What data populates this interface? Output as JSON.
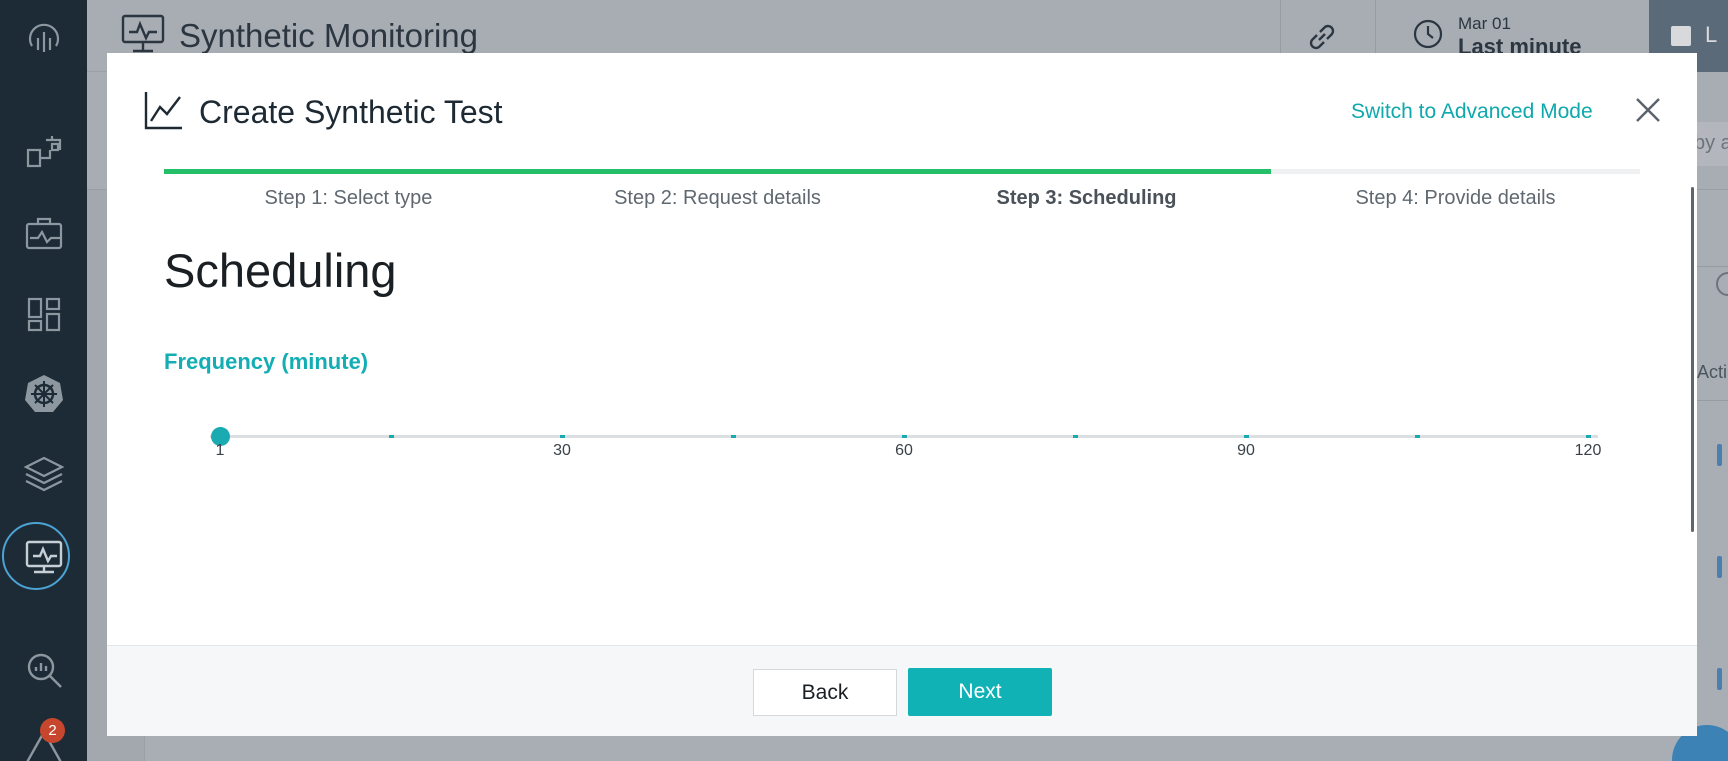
{
  "app": {
    "title": "Synthetic Monitoring",
    "time_picker": {
      "date": "Mar 01",
      "range": "Last minute"
    },
    "right_strip_letter": "L"
  },
  "background_peek": {
    "search_fragment": "by a",
    "column_fragment": "Acti"
  },
  "nav": {
    "items": [
      {
        "name": "logo-icon"
      },
      {
        "name": "dashboards-icon"
      },
      {
        "name": "infrastructure-icon"
      },
      {
        "name": "applications-icon"
      },
      {
        "name": "kubernetes-icon"
      },
      {
        "name": "layers-icon"
      },
      {
        "name": "synthetic-monitoring-icon",
        "active": true
      },
      {
        "name": "analyze-icon"
      },
      {
        "name": "alerts-icon",
        "badge": "2"
      }
    ],
    "active_ring_color": "#4ca3d4",
    "badge_color": "#c7472e"
  },
  "modal": {
    "title": "Create Synthetic Test",
    "advanced_mode_link": "Switch to Advanced Mode",
    "progress_percent": 75,
    "steps": [
      {
        "label": "Step 1: Select type",
        "current": false
      },
      {
        "label": "Step 2: Request details",
        "current": false
      },
      {
        "label": "Step 3: Scheduling",
        "current": true
      },
      {
        "label": "Step 4: Provide details",
        "current": false
      }
    ],
    "section_title": "Scheduling",
    "frequency": {
      "label": "Frequency (minute)",
      "value": 1,
      "min": 1,
      "max": 120,
      "tick_count": 9,
      "scale_labels": [
        "1",
        "30",
        "60",
        "90",
        "120"
      ]
    },
    "footer": {
      "back_label": "Back",
      "next_label": "Next"
    }
  },
  "colors": {
    "accent": "#10b2b5",
    "progress": "#25bf6a",
    "nav_bg": "#1c2b36"
  }
}
